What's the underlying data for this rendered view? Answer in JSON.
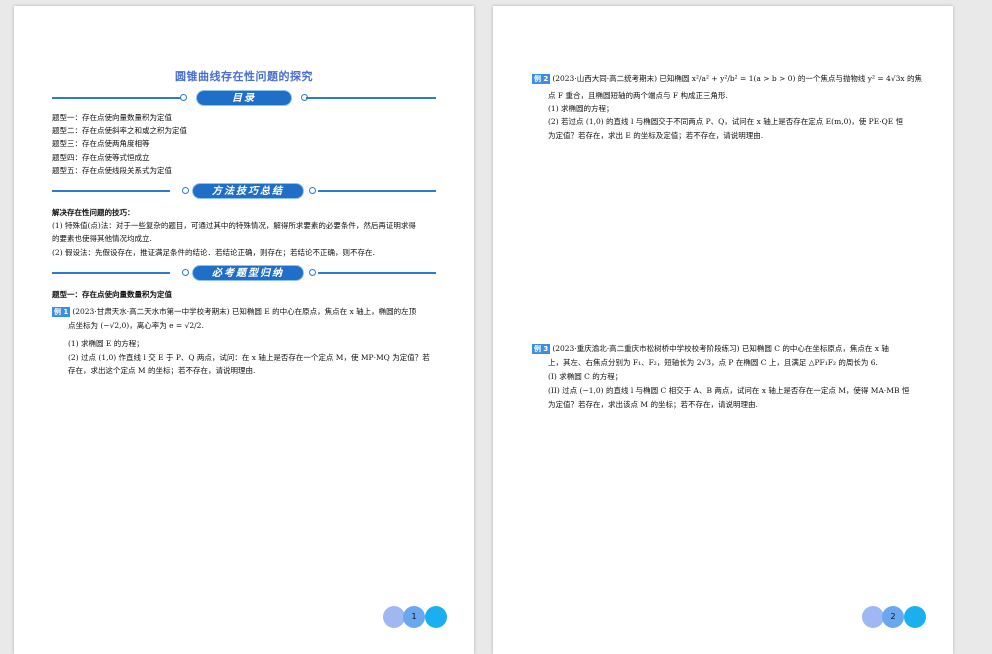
{
  "page1": {
    "title": "圆锥曲线存在性问题的探究",
    "toc_banner": "目录",
    "toc": [
      "题型一：存在点使向量数量积为定值",
      "题型二：存在点使斜率之和或之积为定值",
      "题型三：存在点使两角度相等",
      "题型四：存在点使等式恒成立",
      "题型五：存在点使线段关系式为定值"
    ],
    "methods_banner": "方法技巧总结",
    "methods_heading": "解决存在性问题的技巧：",
    "methods_lines": [
      "(1) 特殊值(点)法：对于一些复杂的题目，可通过其中的特殊情况，解得所求要素的必要条件，然后再证明求得",
      "的要素也使得其他情况均成立.",
      "(2) 假设法：先假设存在，推证满足条件的结论．若结论正确，则存在；若结论不正确，则不存在."
    ],
    "types_banner": "必考题型归纳",
    "type1_heading": "题型一：存在点使向量数量积为定值",
    "ex1_badge": "例 1",
    "ex1_lines": [
      "(2023·甘肃天水·高二天水市第一中学校考期末) 已知椭圆 E 的中心在原点，焦点在 x 轴上，椭圆的左顶",
      "点坐标为 (−√2,0)，离心率为 e = √2/2.",
      "(1) 求椭圆 E 的方程；",
      "(2) 过点 (1,0) 作直线 l 交 E 于 P、Q 两点，试问：在 x 轴上是否存在一个定点 M，使 MP·MQ 为定值？若",
      "存在，求出这个定点 M 的坐标；若不存在，请说明理由."
    ],
    "page_number": "1"
  },
  "page2": {
    "ex2_badge": "例 2",
    "ex2_lines": [
      "(2023·山西大同·高二统考期末) 已知椭圆 x²/a² + y²/b² = 1(a > b > 0) 的一个焦点与抛物线 y² = 4√3x 的焦",
      "点 F 重合，且椭圆短轴的两个端点与 F 构成正三角形.",
      "(1) 求椭圆的方程；",
      "(2) 若过点 (1,0) 的直线 l 与椭圆交于不同两点 P、Q，试问在 x 轴上是否存在定点 E(m,0)，使 PE·QE 恒",
      "为定值？若存在，求出 E 的坐标及定值；若不存在，请说明理由."
    ],
    "ex3_badge": "例 3",
    "ex3_lines": [
      "(2023·重庆渝北·高二重庆市松树桥中学校校考阶段练习) 已知椭圆 C 的中心在坐标原点，焦点在 x 轴",
      "上，其左、右焦点分别为 F₁、F₂，短轴长为 2√3，点 P 在椭圆 C 上，且满足 △PF₁F₂ 的周长为 6.",
      "(I) 求椭圆 C 的方程；",
      "(II) 过点 (−1,0) 的直线 l 与椭圆 C 相交于 A、B 两点，试问在 x 轴上是否存在一定点 M，使得 MA·MB 恒",
      "为定值？若存在，求出该点 M 的坐标；若不存在，请说明理由."
    ],
    "page_number": "2"
  }
}
